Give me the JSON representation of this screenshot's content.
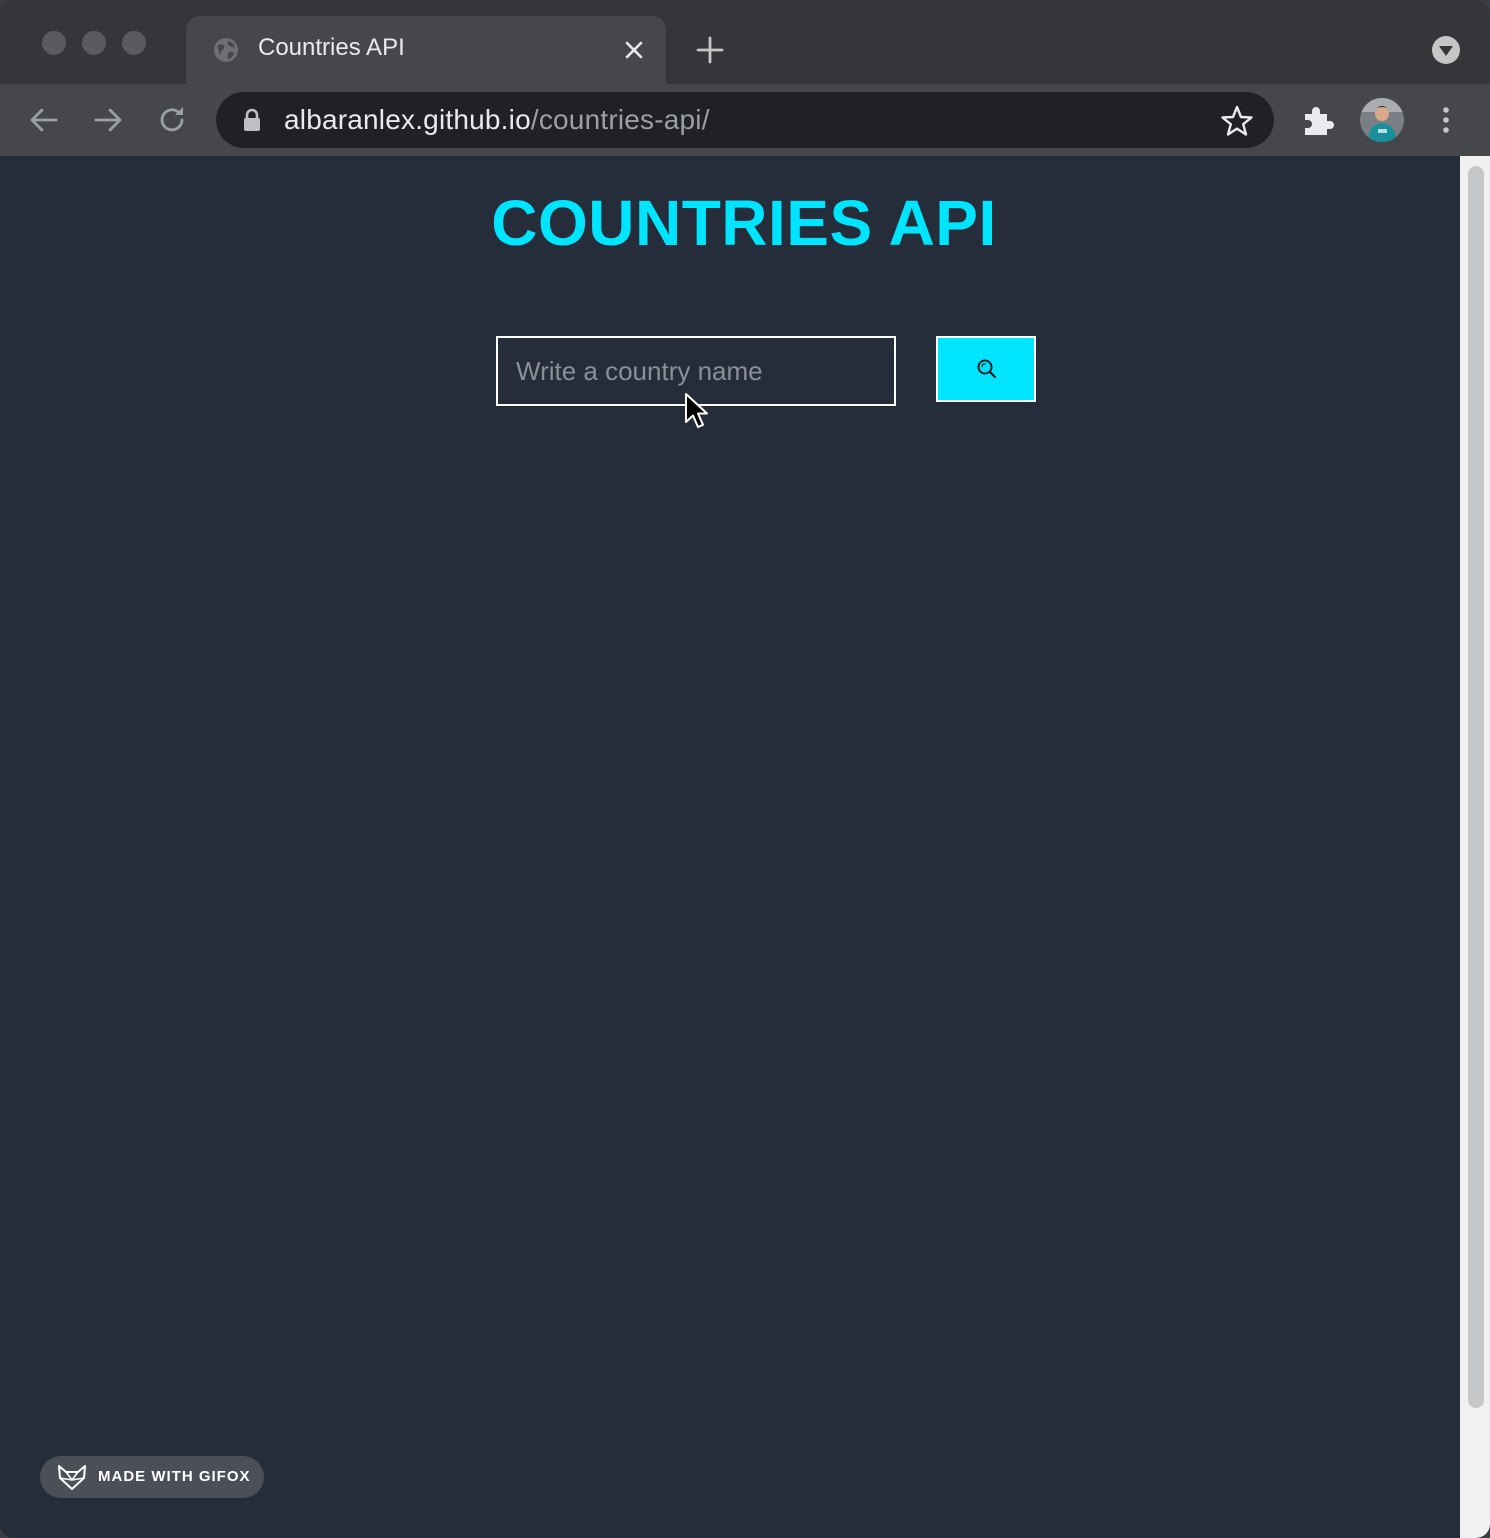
{
  "browser": {
    "tab": {
      "title": "Countries API",
      "favicon": "globe-icon"
    },
    "address_bar": {
      "domain": "albaranlex.github.io",
      "path": "/countries-api/"
    },
    "icons": [
      "back-arrow-icon",
      "forward-arrow-icon",
      "reload-icon",
      "lock-icon",
      "bookmark-star-icon",
      "extensions-puzzle-icon",
      "profile-avatar",
      "menu-kebab-icon",
      "new-tab-plus-icon",
      "tab-close-icon",
      "tab-search-dropdown-icon"
    ]
  },
  "page": {
    "title": "COUNTRIES API",
    "search": {
      "placeholder": "Write a country name",
      "value": ""
    },
    "search_button": {
      "icon": "search-icon"
    }
  },
  "watermark": {
    "label": "MADE WITH GIFOX",
    "icon": "gifox-fox-icon"
  },
  "colors": {
    "accent": "#00e5ff",
    "page_background": "#262d3a",
    "chrome_toolbar": "#45474b",
    "omnibox": "#202124"
  }
}
